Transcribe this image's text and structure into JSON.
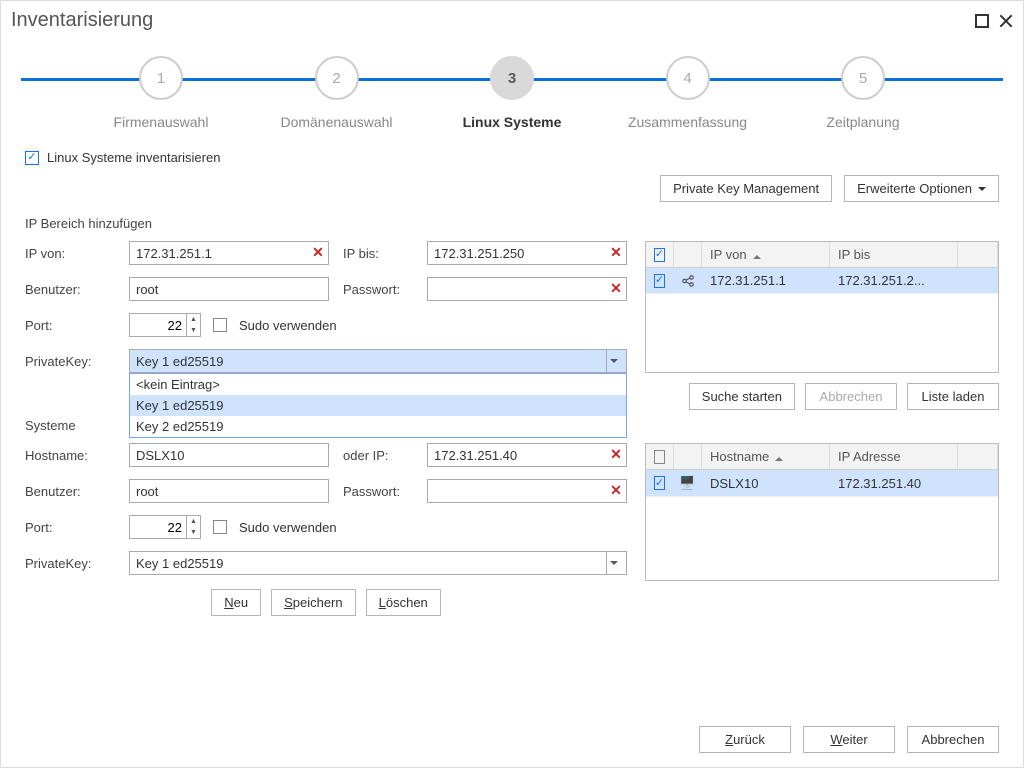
{
  "window": {
    "title": "Inventarisierung"
  },
  "wizard": {
    "steps": [
      {
        "num": "1",
        "label": "Firmenauswahl"
      },
      {
        "num": "2",
        "label": "Domänenauswahl"
      },
      {
        "num": "3",
        "label": "Linux Systeme"
      },
      {
        "num": "4",
        "label": "Zusammenfassung"
      },
      {
        "num": "5",
        "label": "Zeitplanung"
      }
    ],
    "active_index": 2
  },
  "checkbox_inventory_label": "Linux Systeme inventarisieren",
  "toolbar": {
    "private_key_mgmt": "Private Key Management",
    "extended_options": "Erweiterte Optionen"
  },
  "ip_range": {
    "section_label": "IP Bereich hinzufügen",
    "labels": {
      "ip_from": "IP von:",
      "ip_to": "IP bis:",
      "user": "Benutzer:",
      "password": "Passwort:",
      "port": "Port:",
      "sudo": "Sudo verwenden",
      "private_key": "PrivateKey:"
    },
    "ip_from": "172.31.251.1",
    "ip_to": "172.31.251.250",
    "user": "root",
    "password": "",
    "port": "22",
    "private_key_selected": "Key 1 ed25519",
    "private_key_options": [
      "<kein Eintrag>",
      "Key 1 ed25519",
      "Key 2 ed25519"
    ],
    "private_key_selected_index": 1,
    "grid": {
      "headers": {
        "ip_from": "IP von",
        "ip_to": "IP bis"
      },
      "rows": [
        {
          "checked": true,
          "ip_from": "172.31.251.1",
          "ip_to": "172.31.251.2..."
        }
      ]
    },
    "buttons": {
      "search": "Suche starten",
      "cancel": "Abbrechen",
      "load_list": "Liste laden"
    }
  },
  "systems": {
    "section_label": "Systeme",
    "labels": {
      "hostname": "Hostname:",
      "or_ip": "oder IP:",
      "user": "Benutzer:",
      "password": "Passwort:",
      "port": "Port:",
      "sudo": "Sudo verwenden",
      "private_key": "PrivateKey:"
    },
    "hostname": "DSLX10",
    "or_ip": "172.31.251.40",
    "user": "root",
    "password": "",
    "port": "22",
    "private_key_selected": "Key 1 ed25519",
    "grid": {
      "headers": {
        "hostname": "Hostname",
        "ip": "IP Adresse"
      },
      "rows": [
        {
          "checked": true,
          "hostname": "DSLX10",
          "ip": "172.31.251.40"
        }
      ]
    },
    "buttons": {
      "new": "Neu",
      "save": "Speichern",
      "delete": "Löschen"
    }
  },
  "footer": {
    "back": "Zurück",
    "next": "Weiter",
    "cancel": "Abbrechen"
  }
}
